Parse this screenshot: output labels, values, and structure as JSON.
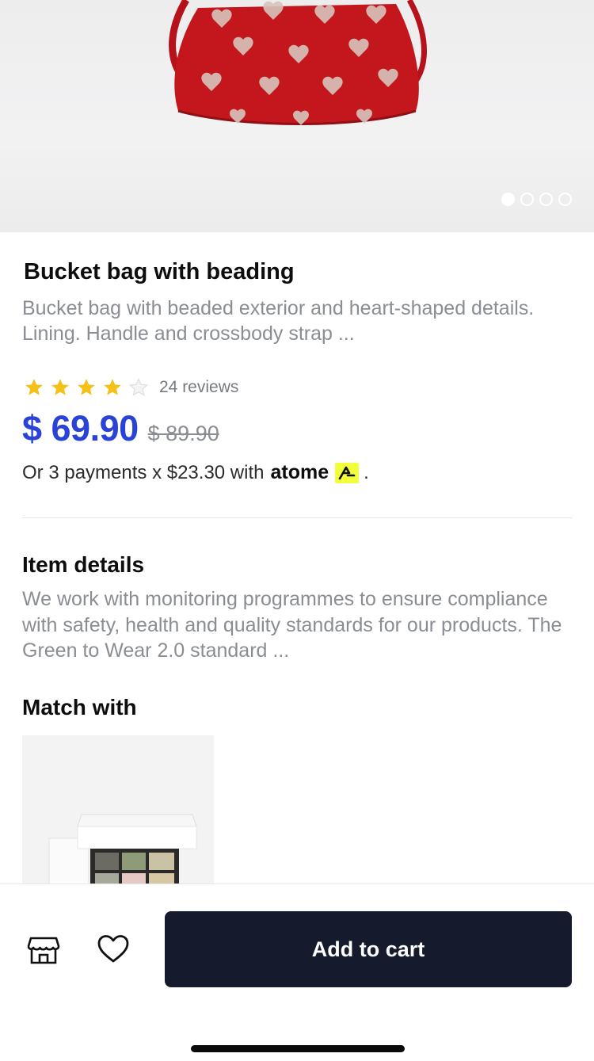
{
  "product": {
    "title": "Bucket bag with beading",
    "description": "Bucket bag with beaded exterior and heart-shaped details. Lining. Handle and crossbody strap ...",
    "rating": 4,
    "rating_max": 5,
    "reviews_label": "24 reviews",
    "price": "$ 69.90",
    "original_price": "$ 89.90",
    "installment_text": "Or 3 payments x $23.30 with",
    "installment_brand": "atome",
    "installment_suffix": "."
  },
  "gallery": {
    "image_count": 4,
    "current_index": 0
  },
  "item_details": {
    "title": "Item details",
    "text": "We work with monitoring programmes to ensure compliance with safety, health and quality standards for our products. The Green to Wear 2.0 standard ..."
  },
  "match_with": {
    "title": "Match with"
  },
  "bottom_bar": {
    "store_icon": "store-icon",
    "wishlist_icon": "heart-icon",
    "add_to_cart_label": "Add to cart"
  },
  "colors": {
    "price": "#2a43d6",
    "cart_button": "#151a2d",
    "star": "#f5c017",
    "atome_badge": "#f2ff3b"
  }
}
